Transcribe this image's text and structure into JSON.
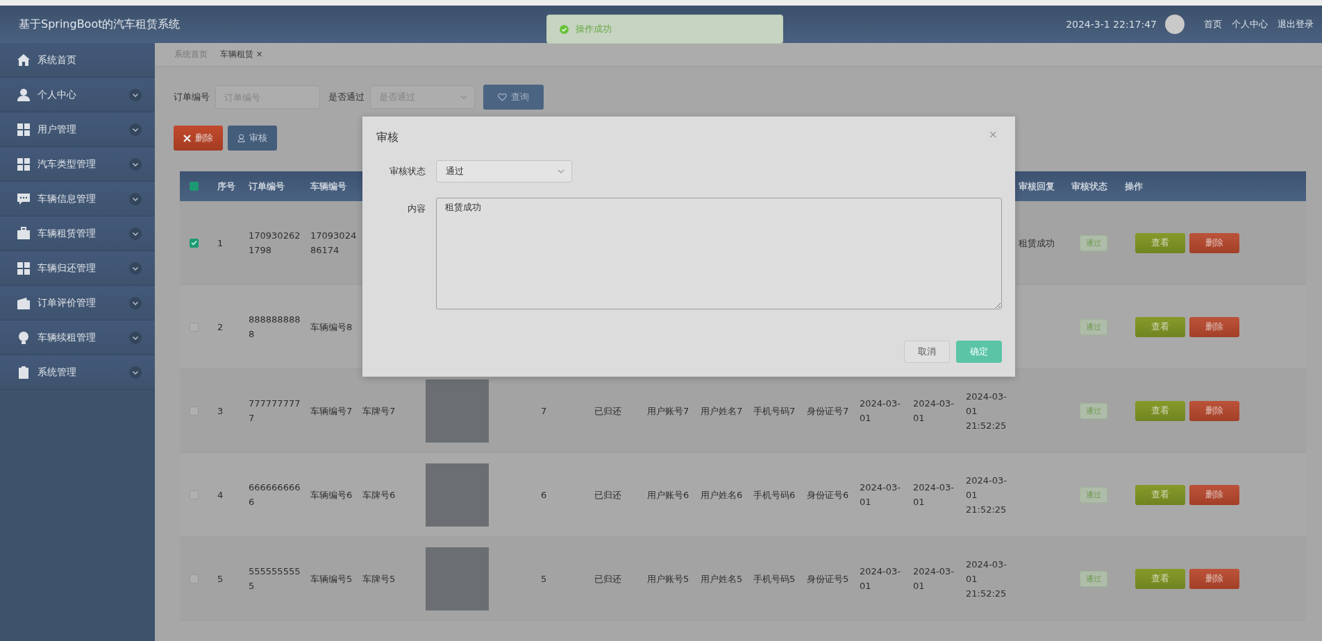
{
  "header": {
    "title": "基于SpringBoot的汽车租赁系统",
    "datetime": "2024-3-1 22:17:47",
    "links": [
      "首页",
      "个人中心",
      "退出登录"
    ]
  },
  "toast": {
    "message": "操作成功"
  },
  "sidebar": {
    "items": [
      {
        "label": "系统首页",
        "expandable": false
      },
      {
        "label": "个人中心",
        "expandable": true
      },
      {
        "label": "用户管理",
        "expandable": true
      },
      {
        "label": "汽车类型管理",
        "expandable": true
      },
      {
        "label": "车辆信息管理",
        "expandable": true
      },
      {
        "label": "车辆租赁管理",
        "expandable": true
      },
      {
        "label": "车辆归还管理",
        "expandable": true
      },
      {
        "label": "订单评价管理",
        "expandable": true
      },
      {
        "label": "车辆续租管理",
        "expandable": true
      },
      {
        "label": "系统管理",
        "expandable": true
      }
    ]
  },
  "breadcrumbs": [
    {
      "label": "系统首页",
      "selected": false
    },
    {
      "label": "车辆租赁",
      "selected": true,
      "close": "×"
    }
  ],
  "search": {
    "fields": [
      {
        "kind": "input",
        "label": "订单编号",
        "placeholder": "订单编号"
      },
      {
        "kind": "select",
        "label": "是否通过",
        "placeholder": "是否通过"
      }
    ],
    "button": "查询"
  },
  "toolbar": [
    {
      "kind": "danger",
      "label": "删除"
    },
    {
      "kind": "primary",
      "label": "审核"
    }
  ],
  "table": {
    "select_all": {
      "indeterminate": true
    },
    "columns": [
      "序号",
      "订单编号",
      "车辆编号",
      null,
      null,
      null,
      null,
      null,
      null,
      null,
      null,
      null,
      null,
      null,
      "审核回复",
      "审核状态",
      "操作"
    ],
    "rows": [
      {
        "checked": true,
        "photo": false,
        "cells": [
          "1",
          "1709302621798",
          "1709302486174",
          null,
          null,
          null,
          null,
          null,
          null,
          null,
          null,
          null,
          null,
          "租赁成功"
        ],
        "status": "通过",
        "actions": [
          "查看",
          "删除"
        ]
      },
      {
        "checked": false,
        "photo": false,
        "cells": [
          "2",
          "8888888888",
          "车辆编号8",
          null,
          null,
          null,
          null,
          null,
          null,
          null,
          null,
          null,
          null,
          null
        ],
        "status": "通过",
        "actions": [
          "查看",
          "删除"
        ]
      },
      {
        "checked": false,
        "photo": true,
        "cells": [
          "3",
          "7777777777",
          "车辆编号7",
          "车牌号7",
          "7",
          "已归还",
          "用户账号7",
          "用户姓名7",
          "手机号码7",
          "身份证号7",
          "2024-03-01",
          "2024-03-01",
          "2024-03-01 21:52:25",
          null
        ],
        "status": "通过",
        "actions": [
          "查看",
          "删除"
        ]
      },
      {
        "checked": false,
        "photo": true,
        "cells": [
          "4",
          "6666666666",
          "车辆编号6",
          "车牌号6",
          "6",
          "已归还",
          "用户账号6",
          "用户姓名6",
          "手机号码6",
          "身份证号6",
          "2024-03-01",
          "2024-03-01",
          "2024-03-01 21:52:25",
          null
        ],
        "status": "通过",
        "actions": [
          "查看",
          "删除"
        ]
      },
      {
        "checked": false,
        "photo": true,
        "cells": [
          "5",
          "5555555555",
          "车辆编号5",
          "车牌号5",
          "5",
          "已归还",
          "用户账号5",
          "用户姓名5",
          "手机号码5",
          "身份证号5",
          "2024-03-01",
          "2024-03-01",
          "2024-03-01 21:52:25",
          null
        ],
        "status": "通过",
        "actions": [
          "查看",
          "删除"
        ]
      }
    ]
  },
  "dialog": {
    "title": "审核",
    "close": "×",
    "fields": [
      {
        "kind": "select",
        "label": "审核状态",
        "value": "通过"
      },
      {
        "kind": "textarea",
        "label": "内容",
        "value": "租赁成功"
      }
    ],
    "buttons": [
      {
        "kind": "secondary",
        "label": "取消"
      },
      {
        "kind": "primary",
        "label": "确定"
      }
    ]
  }
}
